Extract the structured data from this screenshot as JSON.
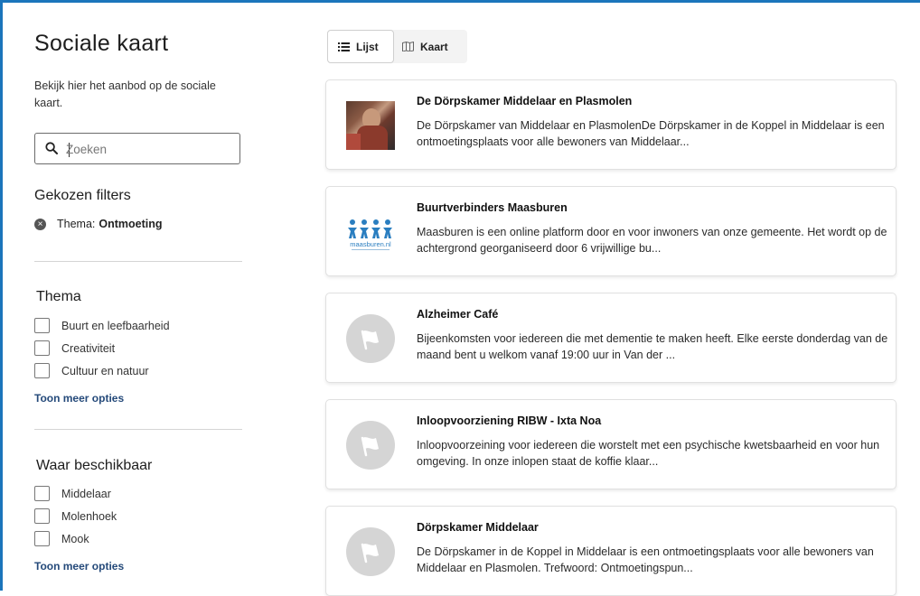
{
  "sidebar": {
    "title": "Sociale kaart",
    "intro": "Bekijk hier het aanbod op de sociale kaart.",
    "search_placeholder": "Zoeken",
    "chosen_filters_title": "Gekozen filters",
    "chosen_filter": {
      "label": "Thema:",
      "value": "Ontmoeting"
    },
    "thema": {
      "title": "Thema",
      "options": [
        "Buurt en leefbaarheid",
        "Creativiteit",
        "Cultuur en natuur"
      ],
      "more": "Toon meer opties"
    },
    "waar": {
      "title": "Waar beschikbaar",
      "options": [
        "Middelaar",
        "Molenhoek",
        "Mook"
      ],
      "more": "Toon meer opties"
    }
  },
  "view_toggle": {
    "list_label": "Lijst",
    "map_label": "Kaart",
    "active": "Lijst"
  },
  "results": [
    {
      "title": "De Dörpskamer Middelaar en Plasmolen",
      "description": "De Dörpskamer van Middelaar en PlasmolenDe Dörpskamer in de Koppel in Middelaar is een ontmoetingsplaats voor alle bewoners van Middelaar...",
      "thumb": "photo"
    },
    {
      "title": "Buurtverbinders Maasburen",
      "description": "Maasburen is een online platform door en voor inwoners van onze gemeente. Het wordt op de achtergrond georganiseerd door 6 vrijwillige bu...",
      "thumb": "logo",
      "logo_text": "maasburen.nl"
    },
    {
      "title": "Alzheimer Café",
      "description": "Bijeenkomsten voor iedereen die met dementie te maken heeft. Elke eerste donderdag van de maand bent u welkom vanaf 19:00 uur in Van der ...",
      "thumb": "flag-placeholder"
    },
    {
      "title": "Inloopvoorziening RIBW - Ixta Noa",
      "description": "Inloopvoorzeining voor iedereen die worstelt met een psychische kwetsbaarheid en voor hun omgeving. In onze inlopen staat de koffie klaar...",
      "thumb": "flag-placeholder"
    },
    {
      "title": "Dörpskamer Middelaar",
      "description": "De Dörpskamer in de Koppel in Middelaar is een ontmoetingsplaats voor alle bewoners van Middelaar en Plasmolen. Trefwoord: Ontmoetingspun...",
      "thumb": "flag-placeholder"
    }
  ],
  "colors": {
    "frame": "#1b75bb",
    "link": "#254a7a",
    "logo": "#2a7ec0"
  },
  "icons": [
    "search-icon",
    "remove-filter-icon",
    "list-icon",
    "map-icon",
    "flag-icon"
  ]
}
